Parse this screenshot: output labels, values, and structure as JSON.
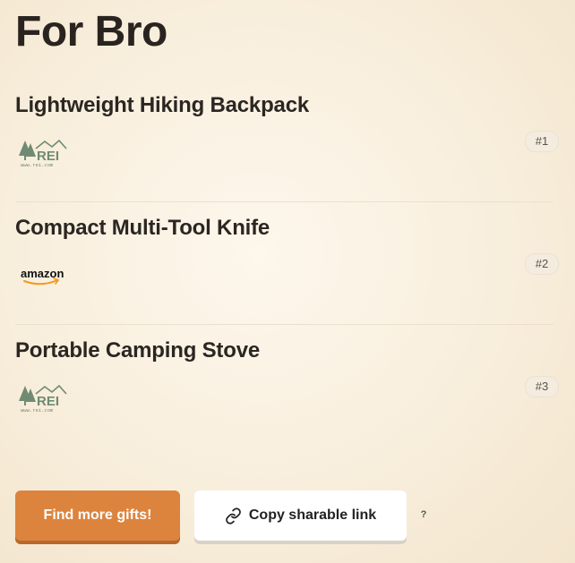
{
  "page": {
    "title": "For Bro"
  },
  "gifts": [
    {
      "name": "Lightweight Hiking Backpack",
      "rank": "#1",
      "store": "rei-logo",
      "logo_url_text": "www.rei.com"
    },
    {
      "name": "Compact Multi-Tool Knife",
      "rank": "#2",
      "store": "amazon-logo",
      "logo_text": "amazon"
    },
    {
      "name": "Portable Camping Stove",
      "rank": "#3",
      "store": "rei-logo",
      "logo_url_text": "www.rei.com"
    }
  ],
  "actions": {
    "find_more_label": "Find more gifts!",
    "copy_link_label": "Copy sharable link",
    "help_label": "?"
  },
  "colors": {
    "primary": "#dc843e",
    "rei_green": "#6f8b73"
  }
}
